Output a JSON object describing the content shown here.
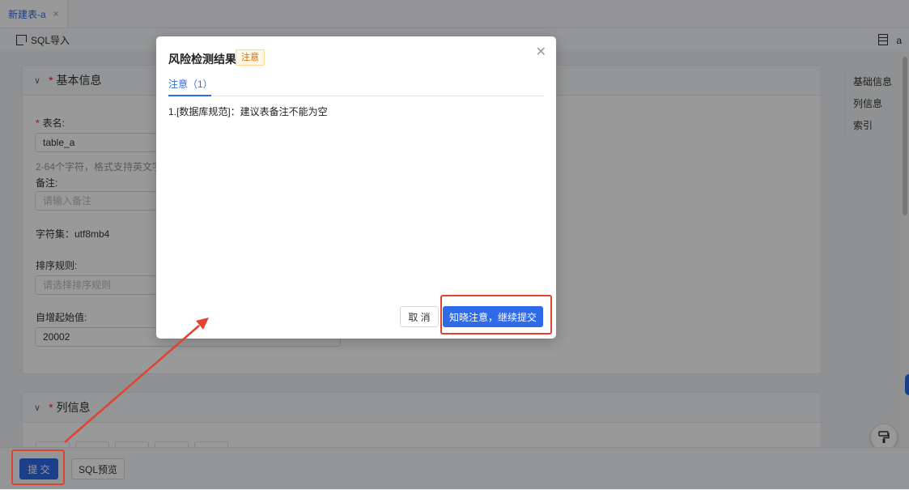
{
  "tab": {
    "title": "新建表-a",
    "close": "×"
  },
  "toolbar": {
    "sql_import": "SQL导入",
    "right_label": "a"
  },
  "basic_section": {
    "title": "基本信息",
    "table_name_label": "表名:",
    "table_name_value": "table_a",
    "table_name_hint": "2-64个字符，格式支持英文字",
    "remark_label": "备注:",
    "remark_placeholder": "请输入备注",
    "charset": "字符集：utf8mb4",
    "collation_label": "排序规则:",
    "collation_placeholder": "请选择排序规则",
    "auto_inc_label": "自增起始值:",
    "auto_inc_value": "20002"
  },
  "column_section": {
    "title": "列信息"
  },
  "right_nav": {
    "items": [
      "基础信息",
      "列信息",
      "索引"
    ]
  },
  "bottom": {
    "submit": "提 交",
    "sql_preview": "SQL预览"
  },
  "modal": {
    "title": "风险检测结果",
    "tag": "注意",
    "tab_label": "注意（1）",
    "items": [
      "1.[数据库规范]：建议表备注不能为空"
    ],
    "cancel": "取 消",
    "confirm": "知晓注意，继续提交"
  },
  "colors": {
    "accent": "#2f6ae8",
    "highlight": "#e0432f",
    "warning_tag": "#d46b08"
  },
  "icons": {
    "sql_import": "import-icon",
    "close": "close-icon",
    "table": "table-icon",
    "paint": "paint-roller-icon"
  }
}
